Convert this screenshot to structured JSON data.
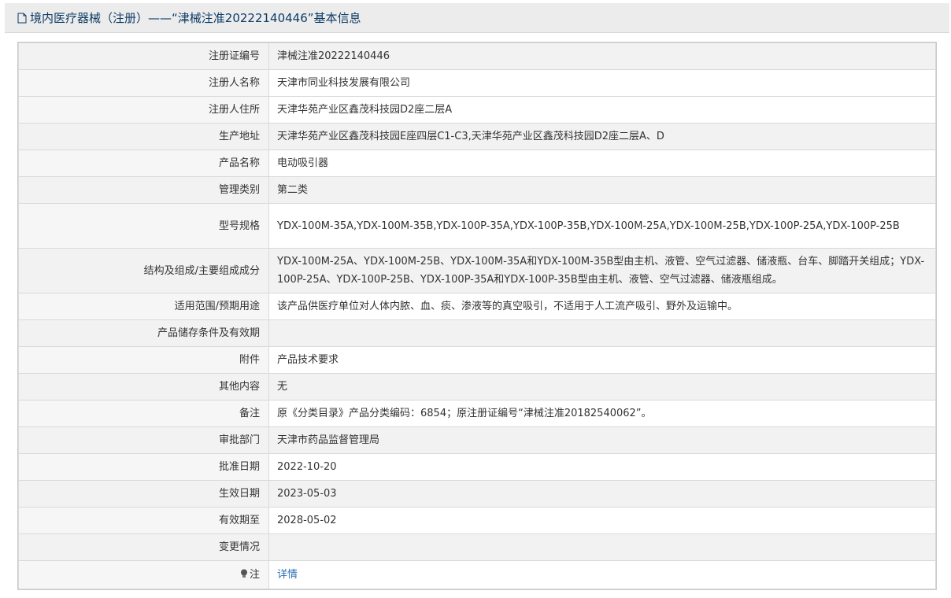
{
  "header": {
    "title": "境内医疗器械（注册）——“津械注准20222140446”基本信息"
  },
  "rows": [
    {
      "label": "注册证编号",
      "value": "津械注准20222140446"
    },
    {
      "label": "注册人名称",
      "value": "天津市同业科技发展有限公司"
    },
    {
      "label": "注册人住所",
      "value": "天津华苑产业区鑫茂科技园D2座二层A"
    },
    {
      "label": "生产地址",
      "value": "天津华苑产业区鑫茂科技园E座四层C1-C3,天津华苑产业区鑫茂科技园D2座二层A、D"
    },
    {
      "label": "产品名称",
      "value": "电动吸引器"
    },
    {
      "label": "管理类别",
      "value": "第二类"
    },
    {
      "label": "型号规格",
      "value": "YDX-100M-35A,YDX-100M-35B,YDX-100P-35A,YDX-100P-35B,YDX-100M-25A,YDX-100M-25B,YDX-100P-25A,YDX-100P-25B"
    },
    {
      "label": "结构及组成/主要组成成分",
      "value": "YDX-100M-25A、YDX-100M-25B、YDX-100M-35A和YDX-100M-35B型由主机、液管、空气过滤器、储液瓶、台车、脚踏开关组成；YDX-100P-25A、YDX-100P-25B、YDX-100P-35A和YDX-100P-35B型由主机、液管、空气过滤器、储液瓶组成。"
    },
    {
      "label": "适用范围/预期用途",
      "value": "该产品供医疗单位对人体内脓、血、痰、渗液等的真空吸引，不适用于人工流产吸引、野外及运输中。"
    },
    {
      "label": "产品储存条件及有效期",
      "value": ""
    },
    {
      "label": "附件",
      "value": "产品技术要求"
    },
    {
      "label": "其他内容",
      "value": "无"
    },
    {
      "label": "备注",
      "value": "原《分类目录》产品分类编码：6854；原注册证编号“津械注准20182540062”。"
    },
    {
      "label": "审批部门",
      "value": "天津市药品监督管理局"
    },
    {
      "label": "批准日期",
      "value": "2022-10-20"
    },
    {
      "label": "生效日期",
      "value": "2023-05-03"
    },
    {
      "label": "有效期至",
      "value": "2028-05-02"
    },
    {
      "label": "变更情况",
      "value": ""
    }
  ],
  "note_row": {
    "label": "注",
    "link_text": "详情",
    "icon": "bulb-icon"
  },
  "colors": {
    "header_text": "#0d3b66",
    "link": "#2a6fb5",
    "label_bg": "#f2f2f2"
  }
}
